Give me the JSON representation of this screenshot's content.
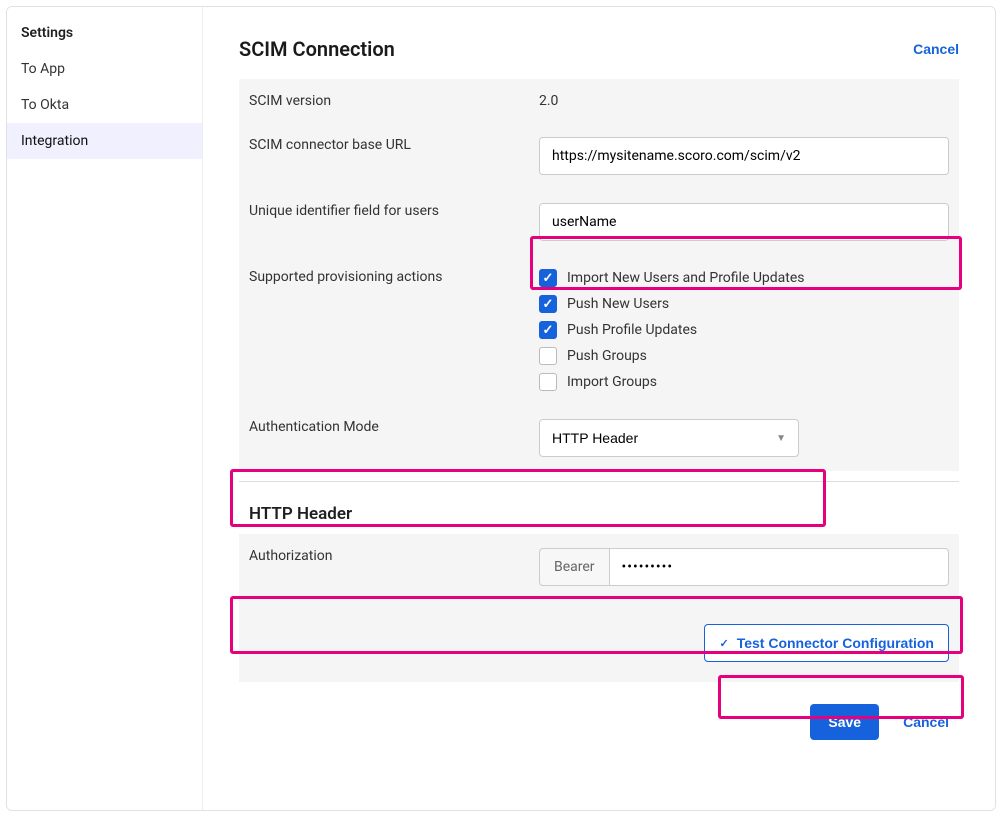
{
  "sidebar": {
    "heading": "Settings",
    "items": [
      {
        "label": "To App",
        "active": false
      },
      {
        "label": "To Okta",
        "active": false
      },
      {
        "label": "Integration",
        "active": true
      }
    ]
  },
  "page": {
    "title": "SCIM Connection",
    "cancel_top": "Cancel"
  },
  "form": {
    "scim_version_label": "SCIM version",
    "scim_version_value": "2.0",
    "base_url_label": "SCIM connector base URL",
    "base_url_value": "https://mysitename.scoro.com/scim/v2",
    "uid_label": "Unique identifier field for users",
    "uid_value": "userName",
    "actions_label": "Supported provisioning actions",
    "actions": [
      {
        "label": "Import New Users and Profile Updates",
        "checked": true
      },
      {
        "label": "Push New Users",
        "checked": true
      },
      {
        "label": "Push Profile Updates",
        "checked": true
      },
      {
        "label": "Push Groups",
        "checked": false
      },
      {
        "label": "Import Groups",
        "checked": false
      }
    ],
    "auth_mode_label": "Authentication Mode",
    "auth_mode_value": "HTTP Header"
  },
  "http_header": {
    "heading": "HTTP Header",
    "auth_label": "Authorization",
    "prefix": "Bearer",
    "token": "•••••••••"
  },
  "buttons": {
    "test": "Test Connector Configuration",
    "save": "Save",
    "cancel": "Cancel"
  }
}
